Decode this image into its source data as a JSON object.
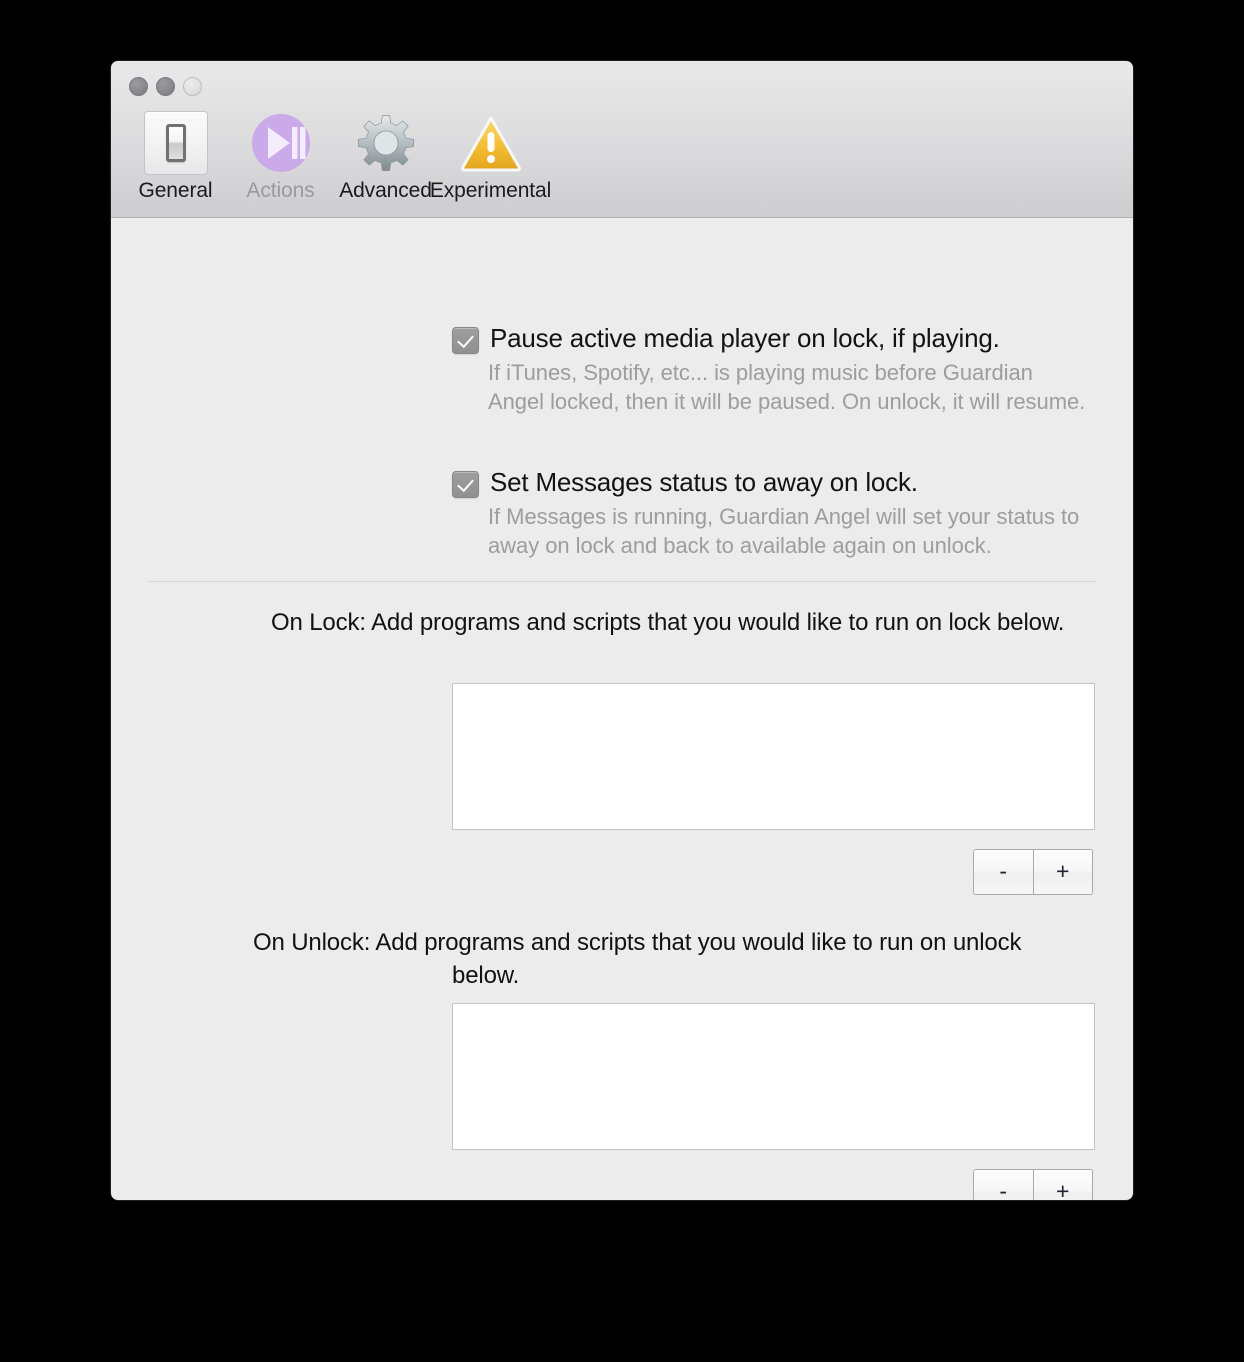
{
  "window": {
    "controls": [
      {
        "name": "close",
        "label": "Close"
      },
      {
        "name": "minimize",
        "label": "Minimize"
      },
      {
        "name": "zoom",
        "label": "Zoom"
      }
    ]
  },
  "toolbar": {
    "tabs": [
      {
        "id": "general",
        "label": "General",
        "icon": "light-switch-icon",
        "selected": true,
        "dim": false
      },
      {
        "id": "actions",
        "label": "Actions",
        "icon": "play-pause-icon",
        "selected": false,
        "dim": true
      },
      {
        "id": "advanced",
        "label": "Advanced",
        "icon": "gear-icon",
        "selected": false,
        "dim": false
      },
      {
        "id": "experimental",
        "label": "Experimental",
        "icon": "warning-triangle-icon",
        "selected": false,
        "dim": false
      }
    ]
  },
  "options": [
    {
      "id": "pause-media",
      "title": "Pause active media player on lock, if playing.",
      "description": "If iTunes, Spotify, etc... is playing music before Guardian Angel locked, then it will be paused. On unlock, it will resume.",
      "checked": true
    },
    {
      "id": "messages-away",
      "title": "Set Messages status to away on lock.",
      "description": "If Messages is running, Guardian Angel will set your status to away on lock and back to available again on unlock.",
      "checked": true
    }
  ],
  "sections": [
    {
      "id": "on-lock",
      "label": "On Lock:",
      "description": "Add programs and scripts that you would like to run on lock below.",
      "list_value": "",
      "remove_label": "-",
      "add_label": "+"
    },
    {
      "id": "on-unlock",
      "label": "On Unlock:",
      "description": "Add programs and scripts that you would like to run on unlock below.",
      "list_value": "",
      "remove_label": "-",
      "add_label": "+"
    }
  ],
  "colors": {
    "content_background": "#ececec",
    "toolbar_top": "#e9e9ea",
    "toolbar_bottom": "#cdcdd0",
    "checkbox_fill": "#979798",
    "description_text": "#9d9d9e",
    "accent_actions": "#c9a8e8",
    "accent_warning": "#f0bd33"
  }
}
